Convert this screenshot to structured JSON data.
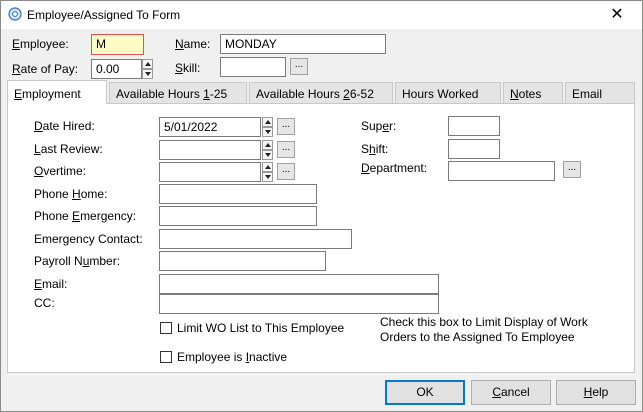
{
  "window": {
    "title": "Employee/Assigned To Form"
  },
  "header": {
    "employee_label": "Employee:",
    "employee_value": "M",
    "name_label": "Name:",
    "name_value": "MONDAY",
    "rate_label": "Rate of Pay:",
    "rate_value": "0.00",
    "skill_label": "Skill:",
    "skill_value": ""
  },
  "tabs": [
    {
      "label": "Employment",
      "active": true
    },
    {
      "label": "Available Hours 1-25",
      "active": false
    },
    {
      "label": "Available Hours 26-52",
      "active": false
    },
    {
      "label": "Hours Worked",
      "active": false
    },
    {
      "label": "Notes",
      "active": false
    },
    {
      "label": "Email",
      "active": false
    }
  ],
  "employment": {
    "date_hired_label": "Date Hired:",
    "date_hired_value": "5/01/2022",
    "last_review_label": "Last Review:",
    "last_review_value": "",
    "overtime_label": "Overtime:",
    "overtime_value": "",
    "phone_home_label": "Phone Home:",
    "phone_emergency_label": "Phone Emergency:",
    "emergency_contact_label": "Emergency Contact:",
    "payroll_number_label": "Payroll Number:",
    "email_label": "Email:",
    "cc_label": "CC:",
    "super_label": "Super:",
    "shift_label": "Shift:",
    "department_label": "Department:",
    "limit_wo_label": "Limit WO List to This Employee",
    "limit_wo_checked": false,
    "limit_wo_help": "Check this box to Limit Display of Work Orders to the Assigned To Employee",
    "inactive_label": "Employee is Inactive",
    "inactive_checked": false
  },
  "buttons": {
    "ok": "OK",
    "cancel": "Cancel",
    "help": "Help",
    "ellipsis": "..."
  }
}
